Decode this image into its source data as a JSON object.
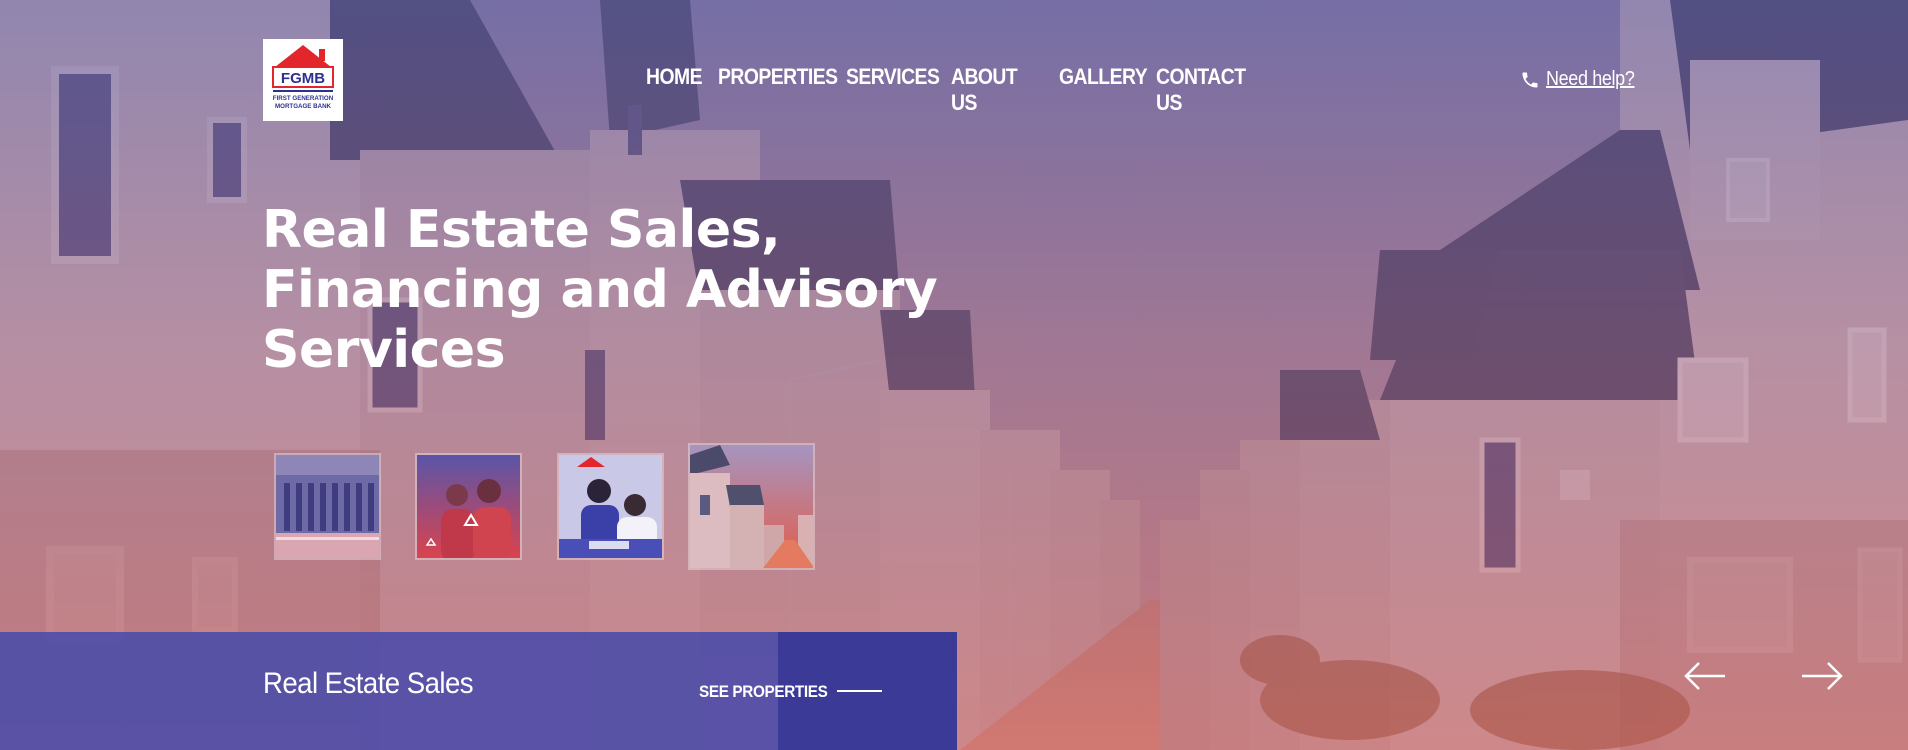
{
  "brand": {
    "logo_abbrev": "FGMB",
    "logo_line1": "FIRST GENERATION",
    "logo_line2": "MORTGAGE BANK",
    "red": "#e3262b",
    "blue": "#2e3192"
  },
  "nav": {
    "items": [
      "HOME",
      "PROPERTIES",
      "SERVICES",
      "ABOUT US",
      "GALLERY",
      "CONTACT US"
    ]
  },
  "help": {
    "label": "Need help?",
    "icon": "phone-icon"
  },
  "hero": {
    "headline_lines": [
      "Real Estate Sales,",
      "Financing and Advisory",
      "Services"
    ],
    "thumbnails": [
      "building-photo",
      "customers-photo",
      "team-photo",
      "estate-photo"
    ]
  },
  "slide": {
    "title": "Real Estate Sales",
    "cta_label": "SEE PROPERTIES"
  },
  "controls": {
    "prev_icon": "arrow-left-icon",
    "next_icon": "arrow-right-icon"
  },
  "colors": {
    "bar": "#4f4ea8",
    "bar_dark": "#3a3a96",
    "overlay_top": "#58549c",
    "overlay_bottom": "#c84646"
  }
}
